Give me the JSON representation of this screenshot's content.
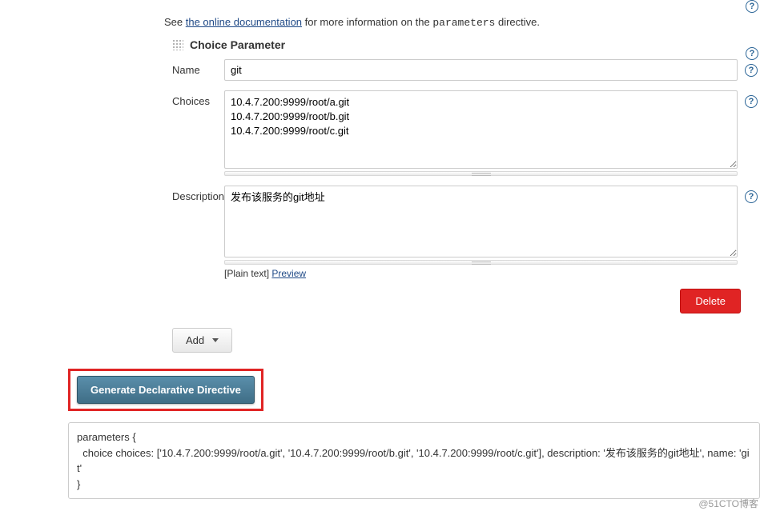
{
  "intro": {
    "prefix": "See ",
    "link_text": "the online documentation",
    "mid": " for more information on the ",
    "code": "parameters",
    "suffix": " directive."
  },
  "section": {
    "title": "Choice Parameter"
  },
  "fields": {
    "name": {
      "label": "Name",
      "value": "git"
    },
    "choices": {
      "label": "Choices",
      "value": "10.4.7.200:9999/root/a.git\n10.4.7.200:9999/root/b.git\n10.4.7.200:9999/root/c.git"
    },
    "description": {
      "label": "Description",
      "value": "发布该服务的git地址",
      "footer_plain": "[Plain text] ",
      "footer_link": "Preview"
    }
  },
  "buttons": {
    "delete": "Delete",
    "add": "Add",
    "generate": "Generate Declarative Directive"
  },
  "output": "parameters {\n  choice choices: ['10.4.7.200:9999/root/a.git', '10.4.7.200:9999/root/b.git', '10.4.7.200:9999/root/c.git'], description: '发布该服务的git地址', name: 'git'\n}",
  "watermark": "@51CTO博客"
}
